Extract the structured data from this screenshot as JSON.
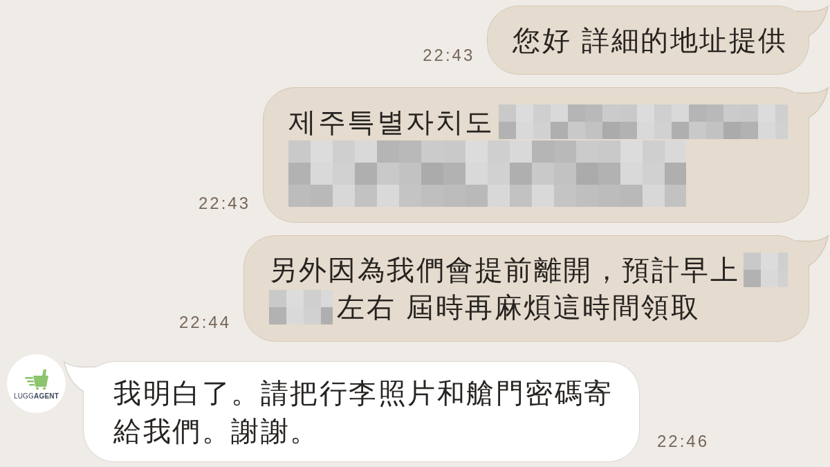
{
  "messages": [
    {
      "kind": "sent",
      "time": "22:43",
      "lines": [
        {
          "segments": [
            {
              "kind": "text",
              "text": "您好 詳細的地址提供"
            }
          ]
        }
      ]
    },
    {
      "kind": "sent",
      "time": "22:43",
      "lines": [
        {
          "segments": [
            {
              "kind": "text",
              "text": "제주특별자치도"
            },
            {
              "kind": "redacted"
            }
          ]
        },
        {
          "segments": [
            {
              "kind": "redacted"
            }
          ]
        }
      ]
    },
    {
      "kind": "sent",
      "time": "22:44",
      "lines": [
        {
          "segments": [
            {
              "kind": "text",
              "text": "另外因為我們會提前離開，預計早上"
            },
            {
              "kind": "redacted"
            }
          ]
        },
        {
          "segments": [
            {
              "kind": "redacted"
            },
            {
              "kind": "text",
              "text": "左右 屆時再麻煩這時間領取"
            }
          ]
        }
      ]
    },
    {
      "kind": "received",
      "sender": {
        "logo_text": "LUGG**AGENT**"
      },
      "time": "22:46",
      "lines": [
        {
          "segments": [
            {
              "kind": "text",
              "text": "我明白了。請把行李照片和艙門密碼寄給我們。謝謝。"
            }
          ]
        }
      ]
    }
  ]
}
